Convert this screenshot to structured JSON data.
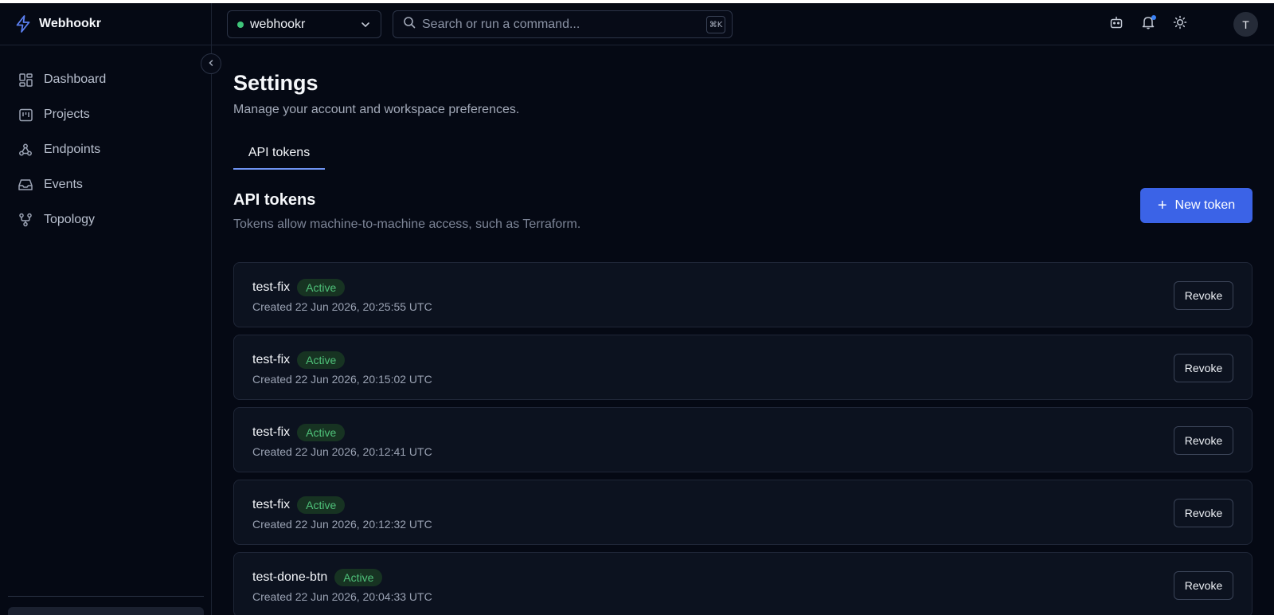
{
  "app": {
    "name": "Webhookr"
  },
  "sidebar": {
    "items": [
      {
        "label": "Dashboard",
        "icon": "dashboard-icon"
      },
      {
        "label": "Projects",
        "icon": "projects-icon"
      },
      {
        "label": "Endpoints",
        "icon": "webhook-icon"
      },
      {
        "label": "Events",
        "icon": "inbox-icon"
      },
      {
        "label": "Topology",
        "icon": "topology-icon"
      }
    ]
  },
  "topbar": {
    "workspace": "webhookr",
    "search_placeholder": "Search or run a command...",
    "search_shortcut": "⌘K",
    "avatar_initial": "T"
  },
  "page": {
    "title": "Settings",
    "subtitle": "Manage your account and workspace preferences."
  },
  "tabs": [
    {
      "label": "API tokens"
    }
  ],
  "section": {
    "title": "API tokens",
    "subtitle": "Tokens allow machine-to-machine access, such as Terraform.",
    "new_button": "New token"
  },
  "tokens": [
    {
      "name": "test-fix",
      "status": "Active",
      "created": "Created 22 Jun 2026, 20:25:55 UTC",
      "action": "Revoke"
    },
    {
      "name": "test-fix",
      "status": "Active",
      "created": "Created 22 Jun 2026, 20:15:02 UTC",
      "action": "Revoke"
    },
    {
      "name": "test-fix",
      "status": "Active",
      "created": "Created 22 Jun 2026, 20:12:41 UTC",
      "action": "Revoke"
    },
    {
      "name": "test-fix",
      "status": "Active",
      "created": "Created 22 Jun 2026, 20:12:32 UTC",
      "action": "Revoke"
    },
    {
      "name": "test-done-btn",
      "status": "Active",
      "created": "Created 22 Jun 2026, 20:04:33 UTC",
      "action": "Revoke"
    }
  ],
  "colors": {
    "background": "#050914",
    "accent": "#3b63e7",
    "status_active": "#4fc27a",
    "workspace_dot": "#3fc57a",
    "notification_dot": "#3b82f6"
  }
}
